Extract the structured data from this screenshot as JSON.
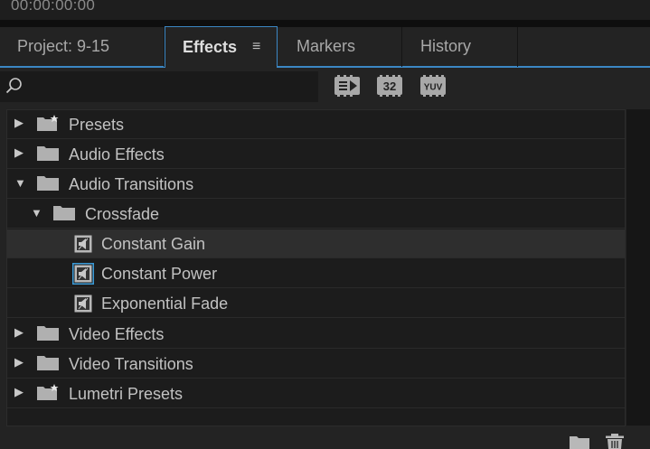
{
  "timecode": "00:00:00:00",
  "tabs": [
    {
      "label": "Project: 9-15",
      "active": false
    },
    {
      "label": "Effects",
      "active": true
    },
    {
      "label": "Markers",
      "active": false
    },
    {
      "label": "History",
      "active": false
    }
  ],
  "tab_menu_icon": "≡",
  "search": {
    "value": "",
    "placeholder": ""
  },
  "filters": [
    {
      "name": "accelerated-effects-icon",
      "text": ""
    },
    {
      "name": "32-bit-color-icon",
      "text": "32"
    },
    {
      "name": "yuv-icon",
      "text": "YUV"
    }
  ],
  "tree": [
    {
      "label": "Presets",
      "type": "preset-folder",
      "expanded": false
    },
    {
      "label": "Audio Effects",
      "type": "folder",
      "expanded": false
    },
    {
      "label": "Audio Transitions",
      "type": "folder",
      "expanded": true
    },
    {
      "label": "Crossfade",
      "type": "folder",
      "expanded": true
    },
    {
      "label": "Constant Gain",
      "type": "effect",
      "selected": true
    },
    {
      "label": "Constant Power",
      "type": "effect",
      "default": true
    },
    {
      "label": "Exponential Fade",
      "type": "effect"
    },
    {
      "label": "Video Effects",
      "type": "folder",
      "expanded": false
    },
    {
      "label": "Video Transitions",
      "type": "folder",
      "expanded": false
    },
    {
      "label": "Lumetri Presets",
      "type": "preset-folder",
      "expanded": false
    }
  ],
  "colors": {
    "accent": "#3b87c4",
    "background": "#232323",
    "tree_bg": "#1c1c1c",
    "selected_row": "#2e2e2e"
  },
  "icons": {
    "expand": "▶",
    "collapse": "▼",
    "new_bin": "folder-icon",
    "delete": "trash-icon"
  }
}
